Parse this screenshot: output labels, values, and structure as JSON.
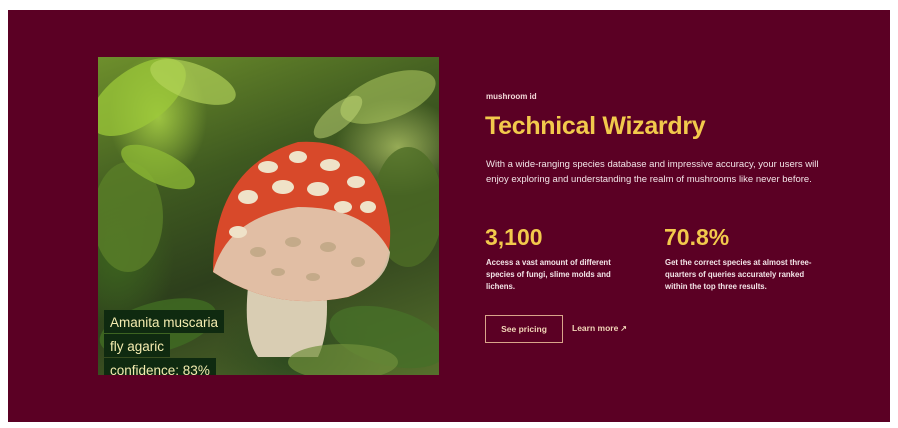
{
  "photo": {
    "tags": {
      "species": "Amanita muscaria",
      "common_name": "fly agaric",
      "confidence": "confidence: 83%"
    }
  },
  "section": {
    "eyebrow": "mushroom id",
    "headline": "Technical Wizardry",
    "description": "With a wide-ranging species database and impressive accuracy, your users will enjoy exploring and understanding the realm of mushrooms like never before."
  },
  "stats": [
    {
      "value": "3,100",
      "description": "Access a vast amount of different species of fungi, slime molds and lichens."
    },
    {
      "value": "70.8%",
      "description": "Get the correct species at almost three-quarters of queries accurately ranked within the top three results."
    }
  ],
  "actions": {
    "primary_label": "See pricing",
    "secondary_label": "Learn more",
    "secondary_icon": "arrow-up-right-icon"
  },
  "colors": {
    "background": "#5b0024",
    "accent": "#f2c94c",
    "tag_background": "#0f2a10"
  }
}
